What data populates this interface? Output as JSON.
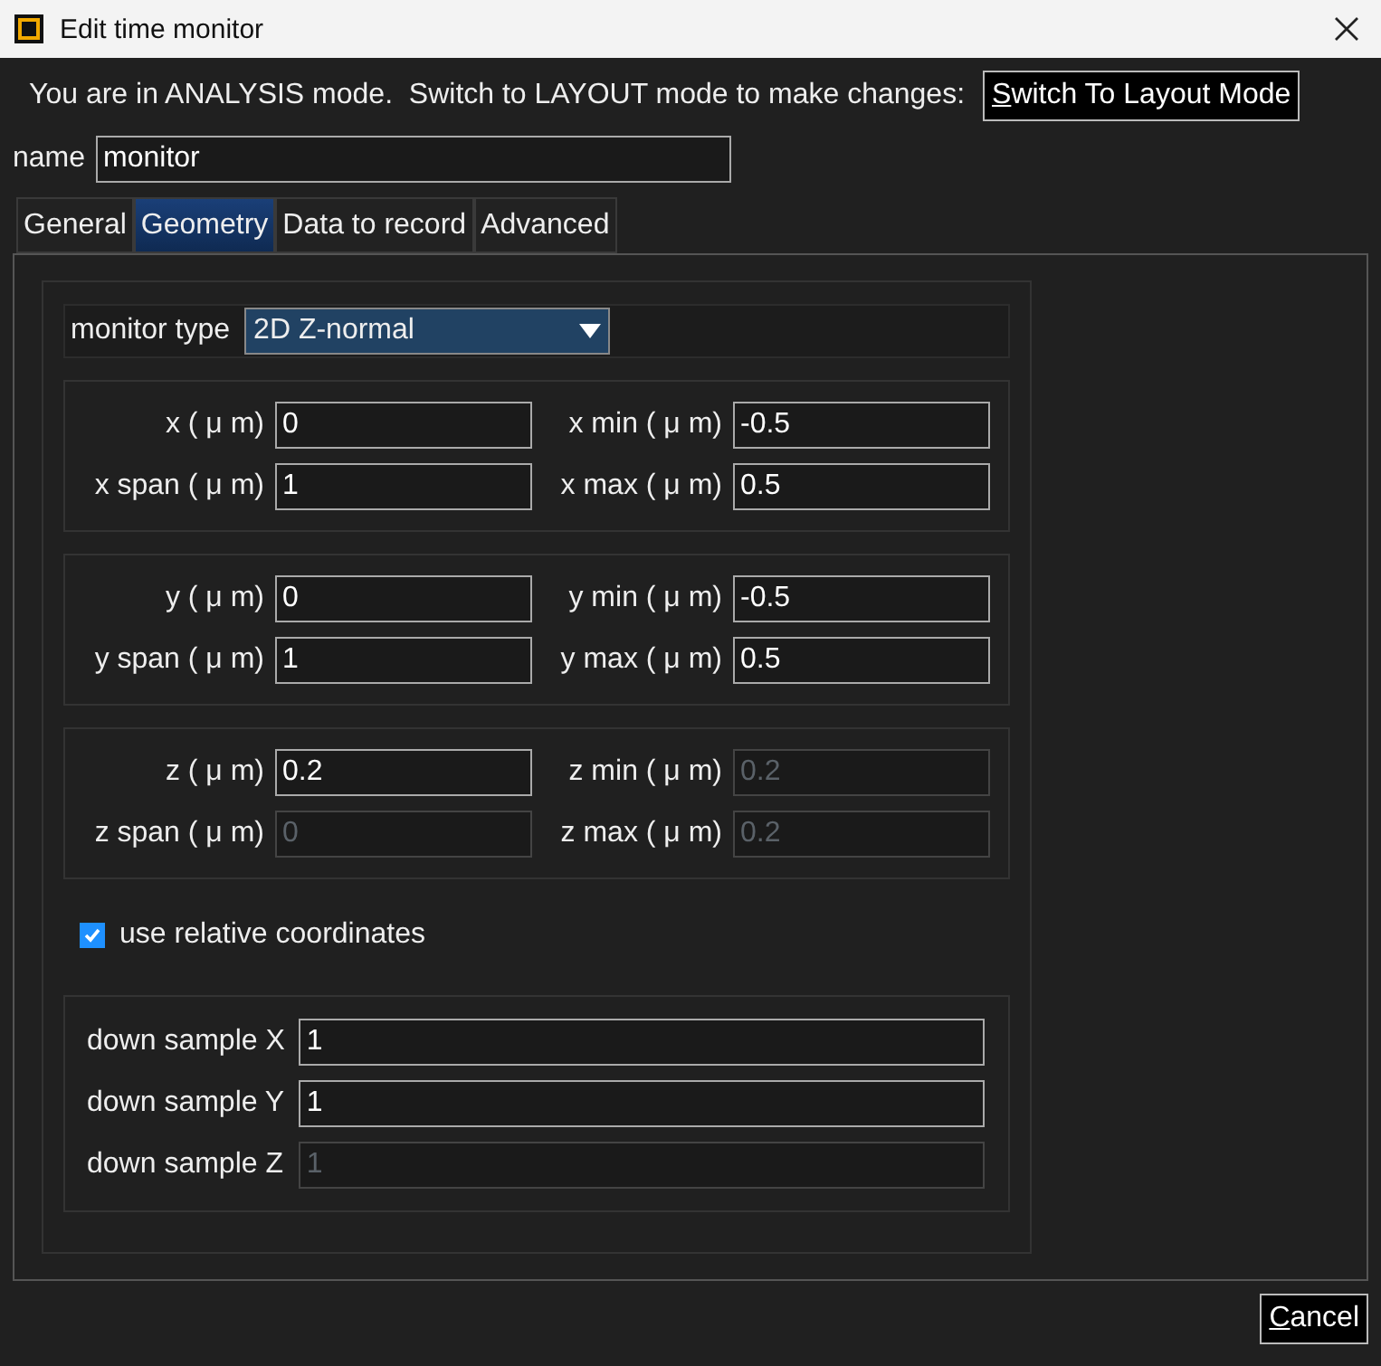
{
  "window": {
    "title": "Edit time monitor"
  },
  "mode_notice": "You are in ANALYSIS mode.  Switch to LAYOUT mode to make changes:",
  "switch_button": "Switch To Layout Mode",
  "name": {
    "label": "name",
    "value": "monitor"
  },
  "tabs": [
    {
      "label": "General",
      "selected": false
    },
    {
      "label": "Geometry",
      "selected": true
    },
    {
      "label": "Data to record",
      "selected": false
    },
    {
      "label": "Advanced",
      "selected": false
    }
  ],
  "monitor_type": {
    "label": "monitor type",
    "value": "2D Z-normal"
  },
  "coordinate_groups": [
    {
      "fields": [
        {
          "label": "x ( μ m)",
          "value": "0",
          "disabled": false
        },
        {
          "label": "x min ( μ m)",
          "value": "-0.5",
          "disabled": false
        },
        {
          "label": "x span ( μ m)",
          "value": "1",
          "disabled": false
        },
        {
          "label": "x max ( μ m)",
          "value": "0.5",
          "disabled": false
        }
      ]
    },
    {
      "fields": [
        {
          "label": "y ( μ m)",
          "value": "0",
          "disabled": false
        },
        {
          "label": "y min ( μ m)",
          "value": "-0.5",
          "disabled": false
        },
        {
          "label": "y span ( μ m)",
          "value": "1",
          "disabled": false
        },
        {
          "label": "y max ( μ m)",
          "value": "0.5",
          "disabled": false
        }
      ]
    },
    {
      "fields": [
        {
          "label": "z ( μ m)",
          "value": "0.2",
          "disabled": false
        },
        {
          "label": "z min ( μ m)",
          "value": "0.2",
          "disabled": true
        },
        {
          "label": "z span ( μ m)",
          "value": "0",
          "disabled": true
        },
        {
          "label": "z max ( μ m)",
          "value": "0.2",
          "disabled": true
        }
      ]
    }
  ],
  "relative_coordinates": {
    "label": "use relative coordinates",
    "checked": true
  },
  "down_sample": [
    {
      "label": "down sample X",
      "value": "1",
      "disabled": false
    },
    {
      "label": "down sample Y",
      "value": "1",
      "disabled": false
    },
    {
      "label": "down sample Z",
      "value": "1",
      "disabled": true
    }
  ],
  "buttons": [
    "Cancel"
  ]
}
